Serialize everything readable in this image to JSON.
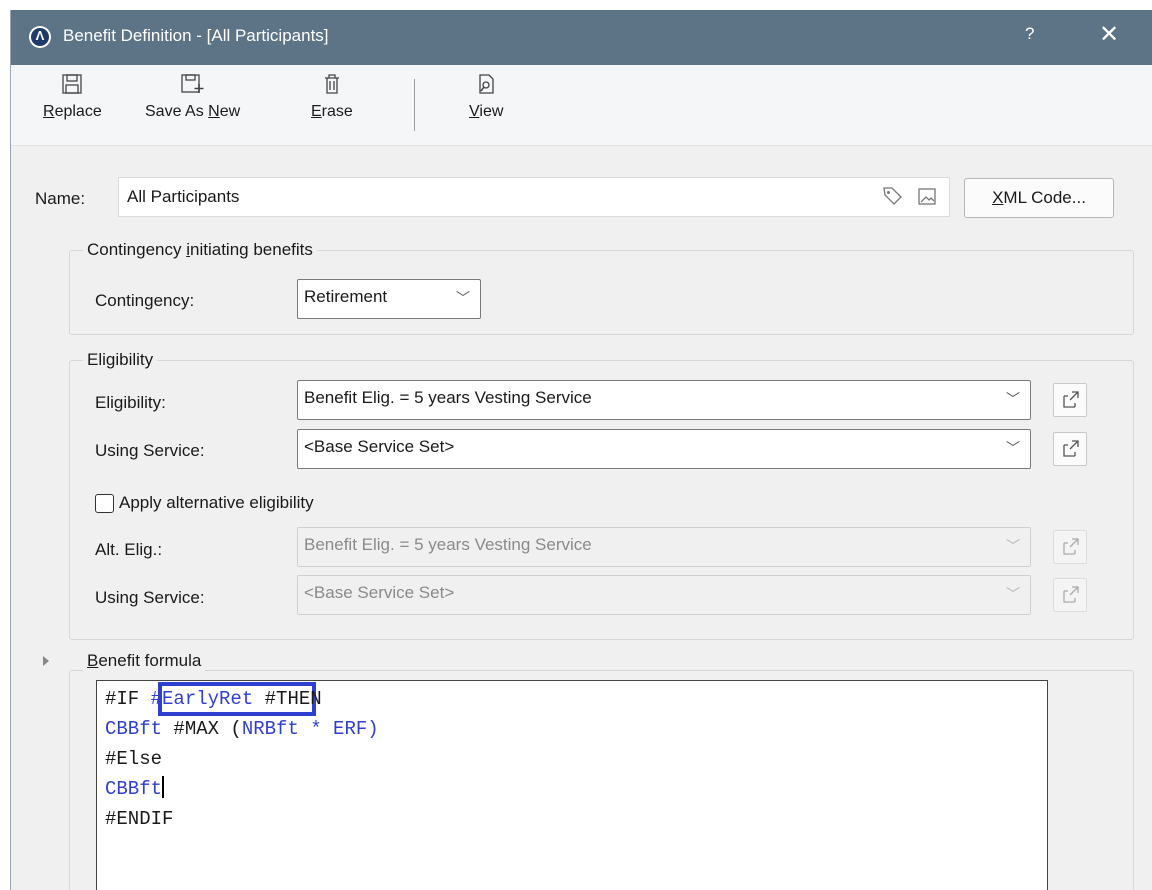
{
  "window": {
    "title": "Benefit Definition - [All Participants]",
    "app_icon": "app-logo-icon",
    "help_glyph": "?",
    "close_glyph": "✕"
  },
  "toolbar": {
    "replace": {
      "prefix": "",
      "u": "R",
      "rest": "eplace"
    },
    "save_as_new": {
      "prefix": "Save As ",
      "u": "N",
      "rest": "ew"
    },
    "erase": {
      "prefix": "",
      "u": "E",
      "rest": "rase"
    },
    "view": {
      "prefix": "",
      "u": "V",
      "rest": "iew"
    }
  },
  "name": {
    "label": "Name:",
    "value": "All Participants",
    "xml_u": "X",
    "xml_rest": "ML Code..."
  },
  "contingency_group": {
    "title_prefix": "Contingency ",
    "title_u": "i",
    "title_rest": "nitiating benefits",
    "contingency_label": "Contingency:",
    "contingency_value": "Retirement"
  },
  "eligibility_group": {
    "title": "Eligibility",
    "eligibility_label": "Eligibility:",
    "eligibility_value": "Benefit Elig. = 5 years Vesting Service",
    "using_service_label": "Using Service:",
    "using_service_value": "<Base Service Set>",
    "apply_alt_label": "Apply alternative eligibility",
    "apply_alt_checked": false,
    "alt_elig_label": "Alt. Elig.:",
    "alt_elig_value": "Benefit Elig. = 5 years Vesting Service",
    "alt_using_service_label": "Using Service:",
    "alt_using_service_value": "<Base Service Set>"
  },
  "formula": {
    "title_u": "B",
    "title_rest": "enefit formula",
    "l1_kw1": "#IF ",
    "l1_id": "#EarlyRet",
    "l1_kw2": " #THEN",
    "l2_id1": "CBBft",
    "l2_kw": " #MAX (",
    "l2_id2": "NRBft * ERF",
    "l2_end": ")",
    "l3_kw": "#Else",
    "l4_id": "CBBft",
    "l5_kw": "#ENDIF",
    "accent": "#2f3fcf"
  }
}
